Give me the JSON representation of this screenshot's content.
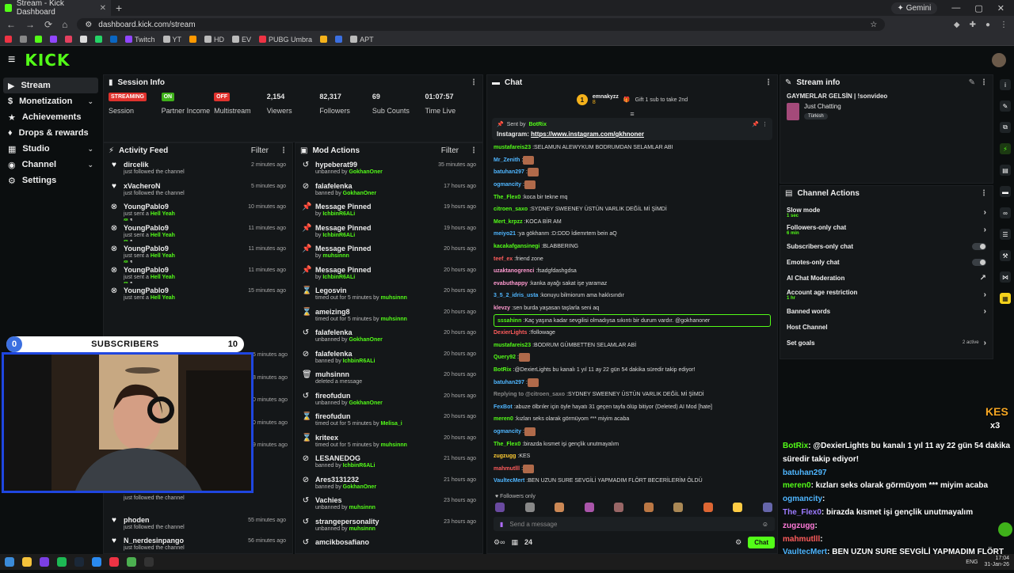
{
  "browser": {
    "tab_title": "Stream - Kick Dashboard",
    "gemini_label": "Gemini",
    "url": "dashboard.kick.com/stream",
    "bookmarks": [
      "Twitch",
      "YT",
      "HD",
      "EV",
      "PUBG Umbra",
      "APT"
    ]
  },
  "brand": {
    "logo": "KICK",
    "accent": "#53fc18"
  },
  "sidebar": {
    "items": [
      {
        "label": "Stream",
        "icon": "stream-icon"
      },
      {
        "label": "Monetization",
        "icon": "dollar-icon"
      },
      {
        "label": "Achievements",
        "icon": "trophy-icon"
      },
      {
        "label": "Drops & rewards",
        "icon": "gift-icon"
      },
      {
        "label": "Studio",
        "icon": "studio-icon"
      },
      {
        "label": "Channel",
        "icon": "channel-icon"
      },
      {
        "label": "Settings",
        "icon": "gear-icon"
      }
    ]
  },
  "session": {
    "title": "Session Info",
    "stats": [
      {
        "value": "STREAMING",
        "label": "Session",
        "badge": true,
        "color": "#e0322d"
      },
      {
        "value": "ON",
        "label": "Partner Income",
        "badge": true,
        "color": "#3fb11a"
      },
      {
        "value": "OFF",
        "label": "Multistream",
        "badge": true,
        "color": "#e0322d"
      },
      {
        "value": "2,154",
        "label": "Viewers"
      },
      {
        "value": "82,317",
        "label": "Followers"
      },
      {
        "value": "69",
        "label": "Sub Counts"
      },
      {
        "value": "01:07:57",
        "label": "Time Live"
      }
    ]
  },
  "activity": {
    "title": "Activity Feed",
    "filter": "Filter",
    "items": [
      {
        "name": "dircelik",
        "sub": "just followed the channel",
        "time": "2 minutes ago",
        "icon": "heart-icon"
      },
      {
        "name": "xVacheroN",
        "sub": "just followed the channel",
        "time": "5 minutes ago",
        "icon": "heart-icon"
      },
      {
        "name": "YoungPablo9",
        "sub": "just sent a",
        "gift": "Hell Yeah",
        "count": "1",
        "time": "10 minutes ago",
        "icon": "kick-icon"
      },
      {
        "name": "YoungPablo9",
        "sub": "just sent a",
        "gift": "Hell Yeah",
        "count": "1",
        "time": "11 minutes ago",
        "icon": "kick-icon"
      },
      {
        "name": "YoungPablo9",
        "sub": "just sent a",
        "gift": "Hell Yeah",
        "count": "1",
        "time": "11 minutes ago",
        "icon": "kick-icon"
      },
      {
        "name": "YoungPablo9",
        "sub": "just sent a",
        "gift": "Hell Yeah",
        "count": "1",
        "time": "11 minutes ago",
        "icon": "kick-icon"
      },
      {
        "name": "YoungPablo9",
        "sub": "just sent a",
        "gift": "Hell Yeah",
        "time": "15 minutes ago",
        "icon": "kick-icon"
      }
    ],
    "below_times": [
      "15 minutes ago",
      "18 minutes ago",
      "20 minutes ago",
      "20 minutes ago",
      "49 minutes ago"
    ],
    "bottom": [
      {
        "name": "",
        "sub": "just followed the channel",
        "time": ""
      },
      {
        "name": "phoden",
        "sub": "just followed the channel",
        "time": "55 minutes ago"
      },
      {
        "name": "N_nerdesinpango",
        "sub": "just followed the channel",
        "time": "56 minutes ago"
      }
    ]
  },
  "overlay": {
    "left": "0",
    "label": "SUBSCRIBERS",
    "right": "10"
  },
  "mod": {
    "title": "Mod Actions",
    "filter": "Filter",
    "items": [
      {
        "title": "hypeberat99",
        "sub": "unbanned by",
        "by": "GokhanOner",
        "time": "35 minutes ago",
        "icon": "undo-icon"
      },
      {
        "title": "falafelenka",
        "sub": "banned by",
        "by": "GokhanOner",
        "time": "17 hours ago",
        "icon": "ban-icon"
      },
      {
        "title": "Message Pinned",
        "sub": "by",
        "by": "IchbinR6ALi",
        "time": "19 hours ago",
        "icon": "pin-icon"
      },
      {
        "title": "Message Pinned",
        "sub": "by",
        "by": "IchbinR6ALi",
        "time": "19 hours ago",
        "icon": "pin-icon"
      },
      {
        "title": "Message Pinned",
        "sub": "by",
        "by": "muhsinnn",
        "time": "20 hours ago",
        "icon": "pin-icon"
      },
      {
        "title": "Message Pinned",
        "sub": "by",
        "by": "IchbinR6ALi",
        "time": "20 hours ago",
        "icon": "pin-icon"
      },
      {
        "title": "Legosvin",
        "sub": "timed out for 5 minutes by",
        "by": "muhsinnn",
        "time": "20 hours ago",
        "icon": "hourglass-icon"
      },
      {
        "title": "ameizing8",
        "sub": "timed out for 5 minutes by",
        "by": "muhsinnn",
        "time": "20 hours ago",
        "icon": "hourglass-icon"
      },
      {
        "title": "falafelenka",
        "sub": "unbanned by",
        "by": "GokhanOner",
        "time": "20 hours ago",
        "icon": "undo-icon"
      },
      {
        "title": "falafelenka",
        "sub": "banned by",
        "by": "IchbinR6ALi",
        "time": "20 hours ago",
        "icon": "ban-icon"
      },
      {
        "title": "muhsinnn",
        "sub": "deleted a message",
        "by": "",
        "time": "20 hours ago",
        "icon": "trash-icon"
      },
      {
        "title": "fireofudun",
        "sub": "unbanned by",
        "by": "GokhanOner",
        "time": "20 hours ago",
        "icon": "undo-icon"
      },
      {
        "title": "fireofudun",
        "sub": "timed out for 5 minutes by",
        "by": "Melisa_i",
        "time": "20 hours ago",
        "icon": "hourglass-icon"
      },
      {
        "title": "kriteex",
        "sub": "timed out for 5 minutes by",
        "by": "muhsinnn",
        "time": "20 hours ago",
        "icon": "hourglass-icon"
      },
      {
        "title": "LESANEDOG",
        "sub": "banned by",
        "by": "IchbinR6ALi",
        "time": "21 hours ago",
        "icon": "ban-icon"
      },
      {
        "title": "Ares3131232",
        "sub": "banned by",
        "by": "GokhanOner",
        "time": "21 hours ago",
        "icon": "ban-icon"
      },
      {
        "title": "Vachies",
        "sub": "unbanned by",
        "by": "muhsinnn",
        "time": "23 hours ago",
        "icon": "undo-icon"
      },
      {
        "title": "strangepersonality",
        "sub": "unbanned by",
        "by": "muhsinnn",
        "time": "23 hours ago",
        "icon": "undo-icon"
      },
      {
        "title": "amcikbosafiano",
        "sub": "",
        "by": "",
        "time": "",
        "icon": "undo-icon"
      }
    ]
  },
  "chat": {
    "title": "Chat",
    "gift_user": "emnakyzz",
    "gift_count": "8",
    "gift_text": "Gift 1 sub to take 2nd",
    "pinned_by": "Sent by",
    "pinned_bot": "BotRix",
    "pinned_text": "Instagram:",
    "pinned_link": "https://www.instagram.com/gkhnoner",
    "messages": [
      {
        "u": "mustafareis23",
        "c": "#53fc18",
        "t": "SELAMUN ALEWYKUM BODRUMDAN SELAMLAR ABI"
      },
      {
        "u": "Mr_Zenith",
        "c": "#4fb6ff",
        "t": ""
      },
      {
        "u": "batuhan297",
        "c": "#4fb6ff",
        "t": ""
      },
      {
        "u": "ogmancity",
        "c": "#4fb6ff",
        "t": ""
      },
      {
        "u": "The_Flex0",
        "c": "#53fc18",
        "t": "koca bir tekne mq"
      },
      {
        "u": "citroen_saxo",
        "c": "#53fc18",
        "t": "SYDNEY SWEENEY ÜSTÜN VARLIK DEĞİL Mİ ŞİMDİ"
      },
      {
        "u": "Mert_krpzz",
        "c": "#53fc18",
        "t": "KOCA BİR AM"
      },
      {
        "u": "meiyo21",
        "c": "#4fb6ff",
        "t": "ya gökhanm :D:DDD İdiemrtem bein aQ"
      },
      {
        "u": "kacakafgansinegi",
        "c": "#53fc18",
        "t": "BLABBERING"
      },
      {
        "u": "teef_ex",
        "c": "#ff5c5c",
        "t": "friend zone"
      },
      {
        "u": "uzaktanogrenci",
        "c": "#ff9ad0",
        "t": "fsadgfdashgdsa"
      },
      {
        "u": "evabuthappy",
        "c": "#ff9ad0",
        "t": "kanka ayağı sakat işe yaramaz"
      },
      {
        "u": "3_5_2_idris_usta",
        "c": "#4fb6ff",
        "t": "konuyu bilmiorum ama haklısındır"
      },
      {
        "u": "klevzy",
        "c": "#ff9ad0",
        "t": "sen burda yaşasan taşlarla seni aq"
      },
      {
        "u": "sssahinn",
        "c": "#53fc18",
        "t": "Kaç yaşına kadar sevgilisi olmadıysa sıkıntı bir durum vardır. @gokhanoner",
        "hl": true
      },
      {
        "u": "DexierLights",
        "c": "#ff5c5c",
        "t": "!followage"
      },
      {
        "u": "mustafareis23",
        "c": "#53fc18",
        "t": "BODRUM GÜMBETTEN SELAMLAR ABİ"
      },
      {
        "u": "Query92",
        "c": "#53fc18",
        "t": ""
      },
      {
        "u": "BotRix",
        "c": "#53fc18",
        "t": "@DexierLights bu kanalı 1 yıl 11 ay 22 gün 54 dakika süredir takip ediyor!"
      },
      {
        "u": "batuhan297",
        "c": "#4fb6ff",
        "t": ""
      },
      {
        "u": "Replying to @citroen_saxo",
        "c": "#888",
        "t": "SYDNEY SWEENEY ÜSTÜN VARLIK DEĞİL Mİ ŞİMDİ"
      },
      {
        "u": "FexBot",
        "c": "#4fb6ff",
        "t": "abuze ölbrıler için öyle hayatı 31 geçen tayfa ölüp bitiyor (Deleted) AI Mod [hate]"
      },
      {
        "u": "meren0",
        "c": "#53fc18",
        "t": "kızları seks olarak görmüyom *** miyim acaba"
      },
      {
        "u": "ogmancity",
        "c": "#4fb6ff",
        "t": ""
      },
      {
        "u": "The_Flex0",
        "c": "#53fc18",
        "t": "birazda kısmet işi gençlik unutmayalım"
      },
      {
        "u": "zugzugg",
        "c": "#ffcc33",
        "t": "KES"
      },
      {
        "u": "mahmutlll",
        "c": "#ff5c5c",
        "t": ""
      },
      {
        "u": "VaultecMert",
        "c": "#4fb6ff",
        "t": "BEN UZUN SURE SEVGİLİ YAPMADIM FLÖRT BECERİLERİM ÖLDÜ"
      }
    ],
    "followers_only": "Followers only",
    "input_placeholder": "Send a message",
    "count": "24",
    "send_label": "Chat"
  },
  "stream_info": {
    "title": "Stream info",
    "stream_title": "GAYMERLAR GELSİN | !sonvideo",
    "category": "Just Chatting",
    "tag": "Türkish"
  },
  "channel_actions": {
    "title": "Channel Actions",
    "rows": [
      {
        "label": "Slow mode",
        "sub": "1 sec",
        "control": "chevron"
      },
      {
        "label": "Followers-only chat",
        "sub": "6 min",
        "control": "chevron"
      },
      {
        "label": "Subscribers-only chat",
        "sub": "",
        "control": "toggle"
      },
      {
        "label": "Emotes-only chat",
        "sub": "",
        "control": "toggle"
      },
      {
        "label": "AI Chat Moderation",
        "sub": "",
        "control": "external"
      },
      {
        "label": "Account age restriction",
        "sub": "1 hr",
        "control": "chevron"
      },
      {
        "label": "Banned words",
        "sub": "",
        "control": "chevron"
      },
      {
        "label": "Host Channel",
        "sub": "",
        "control": "none"
      },
      {
        "label": "Set goals",
        "sub": "",
        "control": "chevron",
        "extra": "2 active"
      }
    ]
  },
  "overlay_chat": [
    {
      "u": "BotRix",
      "c": "#53fc18",
      "t": ": @DexierLights bu kanalı 1 yıl 11 ay 22 gün 54 dakika"
    },
    {
      "u": "",
      "c": "#fff",
      "t": "süredir takip ediyor!"
    },
    {
      "u": "batuhan297",
      "c": "#4fb6ff",
      "t": ""
    },
    {
      "u": "meren0",
      "c": "#53fc18",
      "t": ": kızları seks olarak görmüyom *** miyim acaba"
    },
    {
      "u": "ogmancity",
      "c": "#4fb6ff",
      "t": ":"
    },
    {
      "u": "The_Flex0",
      "c": "#9d7bff",
      "t": ": birazda kısmet işi gençlik unutmayalım"
    },
    {
      "u": "zugzugg",
      "c": "#ff7ad9",
      "t": ":"
    },
    {
      "u": "mahmutlll",
      "c": "#ff5c5c",
      "t": ":"
    },
    {
      "u": "VaultecMert",
      "c": "#4fb6ff",
      "t": ": BEN UZUN SURE SEVGİLİ YAPMADIM FLÖRT"
    },
    {
      "u": "",
      "c": "#fff",
      "t": "BECERİLERİM ÖLDÜ"
    }
  ],
  "overlay_kes": "KES",
  "overlay_x3": "x3",
  "taskbar": {
    "lang": "ENG",
    "time": "17:04",
    "date": "31-Jan-26"
  }
}
